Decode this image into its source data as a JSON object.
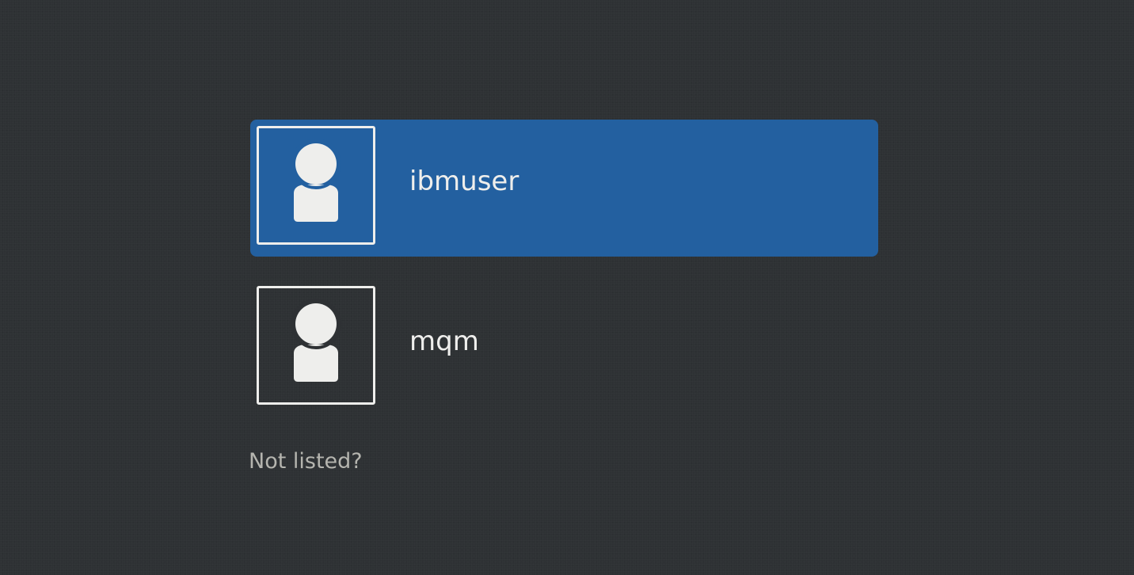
{
  "user_list": {
    "items": [
      {
        "name": "ibmuser",
        "selected": true
      },
      {
        "name": "mqm",
        "selected": false
      }
    ]
  },
  "not_listed_label": "Not listed?",
  "colors": {
    "background": "#2e3134",
    "selection": "#2360a0",
    "text": "#eeeeec",
    "muted_text": "#b5b5af"
  },
  "icons": {
    "avatar": "user-silhouette-icon"
  }
}
